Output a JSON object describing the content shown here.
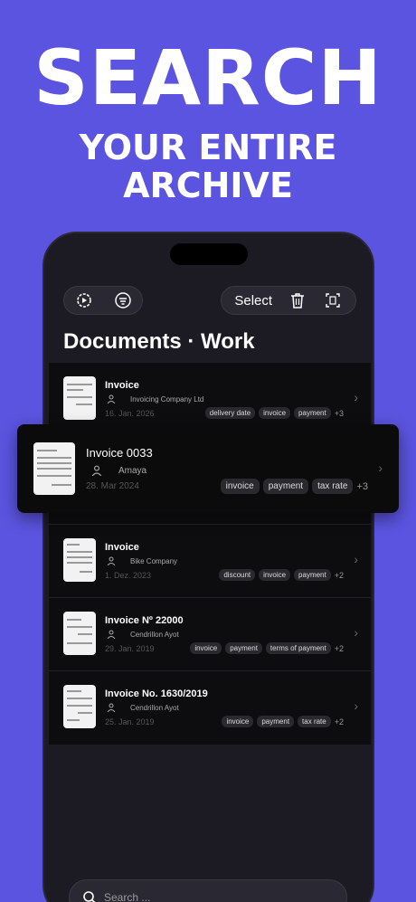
{
  "hero": {
    "title": "SEARCH",
    "subtitle_line1": "YOUR ENTIRE",
    "subtitle_line2": "ARCHIVE"
  },
  "toolbar": {
    "settings_icon": "gear-play-icon",
    "filter_icon": "filter-lines-icon",
    "select_label": "Select",
    "delete_icon": "trash-icon",
    "scan_icon": "document-scan-icon"
  },
  "page_title": "Documents · Work",
  "documents": [
    {
      "title": "Invoice",
      "person": "Invoicing Company Ltd",
      "date": "16. Jan. 2026",
      "tags": [
        "delivery date",
        "invoice",
        "payment"
      ],
      "more": "+3"
    },
    {
      "title": "Invoice",
      "person": "Bike Company",
      "date": "1. Dez. 2023",
      "tags": [
        "discount",
        "invoice",
        "payment"
      ],
      "more": "+2"
    },
    {
      "title": "Invoice Nº 22000",
      "person": "Cendrillon Ayot",
      "date": "29. Jan. 2019",
      "tags": [
        "invoice",
        "payment",
        "terms of payment"
      ],
      "more": "+2"
    },
    {
      "title": "Invoice No. 1630/2019",
      "person": "Cendrillon Ayot",
      "date": "25. Jan. 2019",
      "tags": [
        "invoice",
        "payment",
        "tax rate"
      ],
      "more": "+2"
    }
  ],
  "featured": {
    "title": "Invoice 0033",
    "person": "Amaya",
    "date": "28. Mar 2024",
    "tags": [
      "invoice",
      "payment",
      "tax rate"
    ],
    "more": "+3"
  },
  "search": {
    "placeholder": "Search ..."
  }
}
